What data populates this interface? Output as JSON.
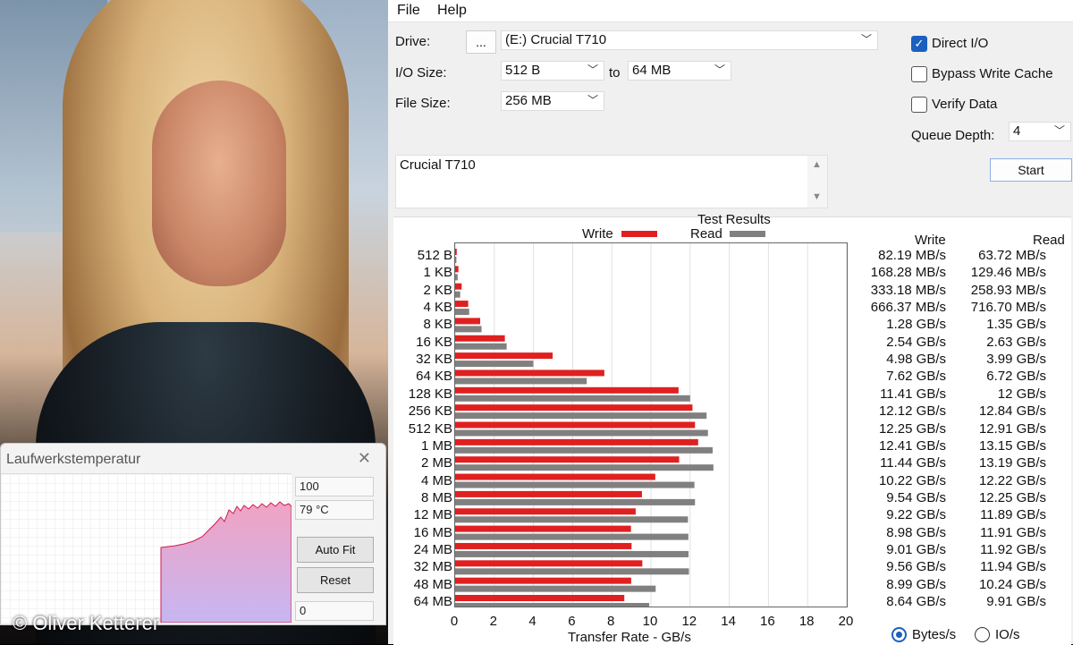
{
  "background": {
    "credit": "© Oliver Ketterer"
  },
  "temp_window": {
    "title": "Laufwerkstemperatur",
    "max_value": "100",
    "current": "79 °C",
    "min_value": "0",
    "autofit_label": "Auto Fit",
    "reset_label": "Reset",
    "fill_color": "#e8a0c8",
    "line_color": "#d01a50"
  },
  "app": {
    "menu": [
      "File",
      "Help"
    ],
    "drive_label": "Drive:",
    "browse_label": "...",
    "drive_value": "(E:) Crucial T710",
    "io_size_label": "I/O Size:",
    "io_from": "512 B",
    "to_label": "to",
    "io_to": "64 MB",
    "file_size_label": "File Size:",
    "file_size": "256 MB",
    "direct_io": {
      "label": "Direct I/O",
      "checked": true
    },
    "bypass_cache": {
      "label": "Bypass Write Cache",
      "checked": false
    },
    "verify_data": {
      "label": "Verify Data",
      "checked": false
    },
    "queue_depth_label": "Queue Depth:",
    "queue_depth": "4",
    "start_label": "Start",
    "description": "Crucial T710",
    "results_title": "Test Results",
    "legend_write": "Write",
    "legend_read": "Read",
    "col_write": "Write",
    "col_read": "Read",
    "units_bytes": "Bytes/s",
    "units_io": "IO/s",
    "units_selected": "Bytes/s"
  },
  "chart_data": {
    "type": "bar",
    "orientation": "horizontal",
    "title": "Test Results",
    "xlabel": "Transfer Rate - GB/s",
    "xlim": [
      0,
      20
    ],
    "xticks": [
      0,
      2,
      4,
      6,
      8,
      10,
      12,
      14,
      16,
      18,
      20
    ],
    "categories": [
      "512 B",
      "1 KB",
      "2 KB",
      "4 KB",
      "8 KB",
      "16 KB",
      "32 KB",
      "64 KB",
      "128 KB",
      "256 KB",
      "512 KB",
      "1 MB",
      "2 MB",
      "4 MB",
      "8 MB",
      "12 MB",
      "16 MB",
      "24 MB",
      "32 MB",
      "48 MB",
      "64 MB"
    ],
    "series": [
      {
        "name": "Write",
        "color": "#e02020",
        "values": [
          0.08219,
          0.16828,
          0.33318,
          0.66637,
          1.28,
          2.54,
          4.98,
          7.62,
          11.41,
          12.12,
          12.25,
          12.41,
          11.44,
          10.22,
          9.54,
          9.22,
          8.98,
          9.01,
          9.56,
          8.99,
          8.64
        ]
      },
      {
        "name": "Read",
        "color": "#808080",
        "values": [
          0.06372,
          0.12946,
          0.25893,
          0.7167,
          1.35,
          2.63,
          3.99,
          6.72,
          12,
          12.84,
          12.91,
          13.15,
          13.19,
          12.22,
          12.25,
          11.89,
          11.91,
          11.92,
          11.94,
          10.24,
          9.91
        ]
      }
    ],
    "labels_write": [
      "82.19 MB/s",
      "168.28 MB/s",
      "333.18 MB/s",
      "666.37 MB/s",
      "1.28 GB/s",
      "2.54 GB/s",
      "4.98 GB/s",
      "7.62 GB/s",
      "11.41 GB/s",
      "12.12 GB/s",
      "12.25 GB/s",
      "12.41 GB/s",
      "11.44 GB/s",
      "10.22 GB/s",
      "9.54 GB/s",
      "9.22 GB/s",
      "8.98 GB/s",
      "9.01 GB/s",
      "9.56 GB/s",
      "8.99 GB/s",
      "8.64 GB/s"
    ],
    "labels_read": [
      "63.72 MB/s",
      "129.46 MB/s",
      "258.93 MB/s",
      "716.70 MB/s",
      "1.35 GB/s",
      "2.63 GB/s",
      "3.99 GB/s",
      "6.72 GB/s",
      "12 GB/s",
      "12.84 GB/s",
      "12.91 GB/s",
      "13.15 GB/s",
      "13.19 GB/s",
      "12.22 GB/s",
      "12.25 GB/s",
      "11.89 GB/s",
      "11.91 GB/s",
      "11.92 GB/s",
      "11.94 GB/s",
      "10.24 GB/s",
      "9.91 GB/s"
    ],
    "grid": true,
    "legend_placement": "top"
  }
}
